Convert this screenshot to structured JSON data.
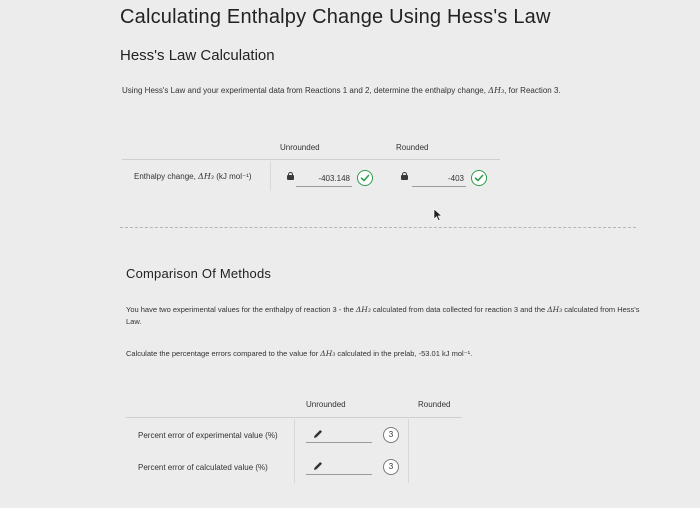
{
  "title": "Calculating Enthalpy Change Using Hess's Law",
  "section": "Hess's Law Calculation",
  "instruction": {
    "pre": "Using Hess's Law and your experimental data from Reactions 1 and 2, determine the enthalpy change, ",
    "math": "ΔH₃",
    "post": ", for Reaction 3."
  },
  "table1": {
    "col_unrounded": "Unrounded",
    "col_rounded": "Rounded",
    "row_label_pre": "Enthalpy change, ",
    "row_label_math": "ΔH₃",
    "row_label_unit": " (kJ mol⁻¹)",
    "unrounded_value": "-403.148",
    "rounded_value": "-403"
  },
  "comparison": {
    "title": "Comparison Of Methods",
    "para1_pre": "You have two experimental values for the enthalpy of reaction 3 - the ",
    "para1_math1": "ΔH₃",
    "para1_mid": " calculated from data collected for reaction 3 and the ",
    "para1_math2": "ΔH₃",
    "para1_post": " calculated from Hess's Law.",
    "para2_pre": "Calculate the percentage errors compared to the value for ",
    "para2_math": "ΔH₃",
    "para2_post": " calculated in the prelab, -53.01 kJ mol⁻¹."
  },
  "table2": {
    "col_unrounded": "Unrounded",
    "col_rounded": "Rounded",
    "rows": [
      {
        "label": "Percent error of experimental value (%)",
        "badge": "3"
      },
      {
        "label": "Percent error of calculated value (%)",
        "badge": "3"
      }
    ]
  },
  "colors": {
    "check": "#2e9b4a",
    "background": "#ececec"
  }
}
